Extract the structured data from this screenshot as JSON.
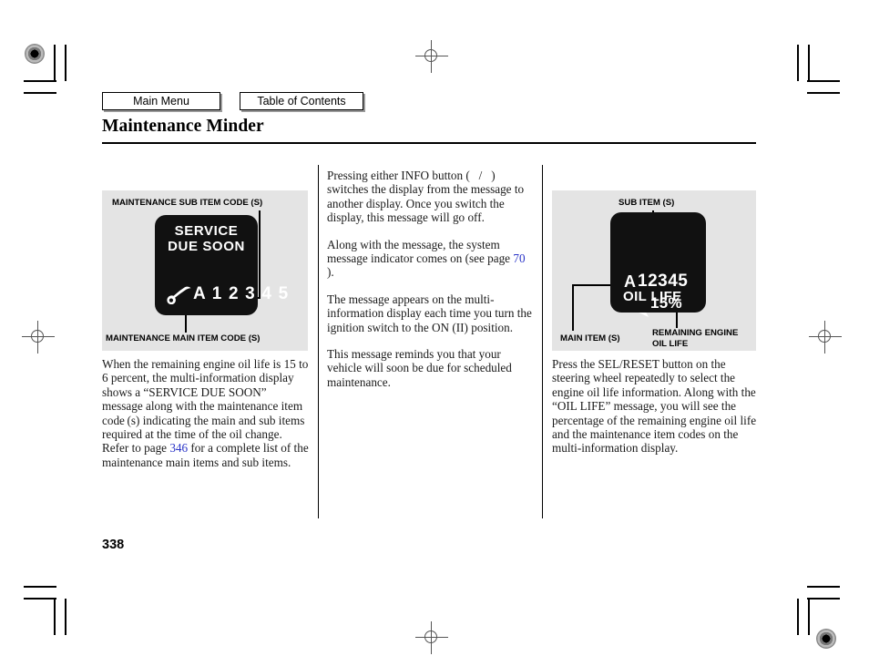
{
  "nav": {
    "main_menu": "Main Menu",
    "table_of_contents": "Table of Contents"
  },
  "header": {
    "title": "Maintenance Minder"
  },
  "folio": {
    "page_number": "338"
  },
  "figure_left": {
    "caption_top": "MAINTENANCE SUB ITEM CODE (S)",
    "caption_bottom": "MAINTENANCE MAIN ITEM CODE (S)",
    "display": {
      "line1": "SERVICE",
      "line2": "DUE SOON",
      "code": "A 1 2 3 4 5",
      "wrench_icon": "wrench-icon"
    }
  },
  "figure_right": {
    "caption_top": "SUB ITEM (S)",
    "caption_bottom_left": "MAIN ITEM (S)",
    "caption_bottom_right_line1": "REMAINING ENGINE",
    "caption_bottom_right_line2": "OIL LIFE",
    "display": {
      "code_main": "A",
      "code_sub": "12345",
      "oil_life_label": "OIL LIFE",
      "oil_life_value": "15%"
    }
  },
  "columns": {
    "left": [
      "When the remaining engine oil life is 15 to 6 percent, the multi-information display shows a “SERVICE DUE SOON” message along with the maintenance item code (s) indicating the main and sub items required at the time of the oil change. Refer to page 346 for a complete list of the maintenance main items and sub items."
    ],
    "left_pageref": "346",
    "middle": [
      "Pressing either INFO button (    /    ) switches the display from the message to another display. Once you switch the display, this message will go off.",
      "Along with the message, the system message indicator comes on (see page 70 ).",
      "The message appears on the multi-information display each time you turn the ignition switch to the ON (II) position.",
      "This message reminds you that your vehicle will soon be due for scheduled maintenance."
    ],
    "middle_pageref": "70",
    "right": [
      "Press the SEL/RESET button on the steering wheel repeatedly to select the engine oil life information. Along with the “OIL LIFE” message, you will see the percentage of the remaining engine oil life and the maintenance item codes on the multi-information display."
    ]
  },
  "colors": {
    "figure_background": "#e4e4e4",
    "lcd_background": "#111111",
    "pageref_link": "#2b35c8"
  }
}
